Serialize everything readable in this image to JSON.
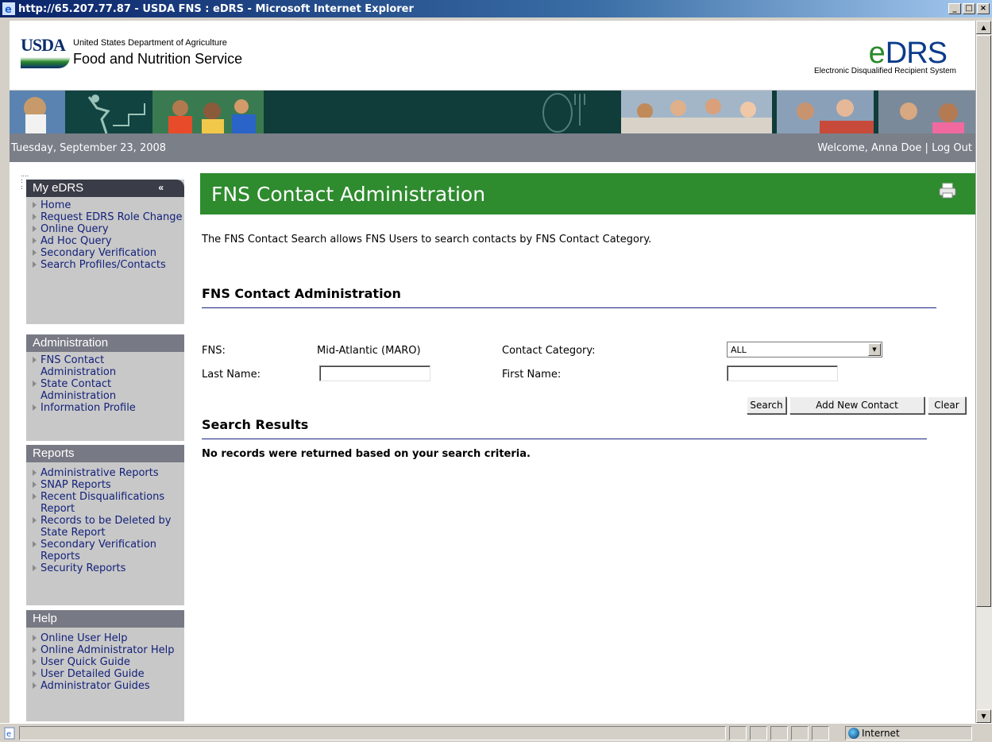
{
  "window": {
    "title": "http://65.207.77.87 - USDA FNS : eDRS - Microsoft Internet Explorer",
    "controls": {
      "minimize": "_",
      "maximize": "□",
      "close": "×"
    }
  },
  "header": {
    "usda": "USDA",
    "agency_small": "United States Department of Agriculture",
    "agency_big": "Food and Nutrition Service",
    "logo_e": "e",
    "logo_caps": "DRS",
    "logo_sub": "Electronic Disqualified Recipient System"
  },
  "datebar": {
    "date": "Tuesday, September 23, 2008",
    "welcome": "Welcome, Anna Doe",
    "separator": " | ",
    "logout": "Log Out"
  },
  "sidebar": {
    "my_edrs": {
      "title": "My eDRS",
      "collapse": "«",
      "items": [
        "Home",
        "Request EDRS Role Change",
        "Online Query",
        "Ad Hoc Query",
        "Secondary Verification",
        "Search Profiles/Contacts"
      ]
    },
    "administration": {
      "title": "Administration",
      "items": [
        "FNS Contact Administration",
        "State Contact Administration",
        "Information Profile"
      ]
    },
    "reports": {
      "title": "Reports",
      "items": [
        "Administrative Reports",
        "SNAP Reports",
        "Recent Disqualifications Report",
        "Records to be Deleted by State Report",
        "Secondary Verification Reports",
        "Security Reports"
      ]
    },
    "help": {
      "title": "Help",
      "items": [
        "Online User Help",
        "Online Administrator Help",
        "User Quick Guide",
        "User Detailed Guide",
        "Administrator Guides"
      ]
    }
  },
  "main": {
    "page_title": "FNS Contact Administration",
    "intro": "The FNS Contact Search allows FNS Users to search contacts by FNS Contact Category.",
    "section_title": "FNS Contact Administration",
    "form": {
      "fns_label": "FNS:",
      "fns_value": "Mid-Atlantic (MARO)",
      "category_label": "Contact Category:",
      "category_value": "ALL",
      "last_name_label": "Last Name:",
      "last_name_value": "",
      "first_name_label": "First Name:",
      "first_name_value": ""
    },
    "buttons": {
      "search": "Search",
      "add": "Add New Contact",
      "clear": "Clear"
    },
    "results_title": "Search Results",
    "no_records": "No records were returned based on your search criteria."
  },
  "statusbar": {
    "zone": "Internet"
  }
}
